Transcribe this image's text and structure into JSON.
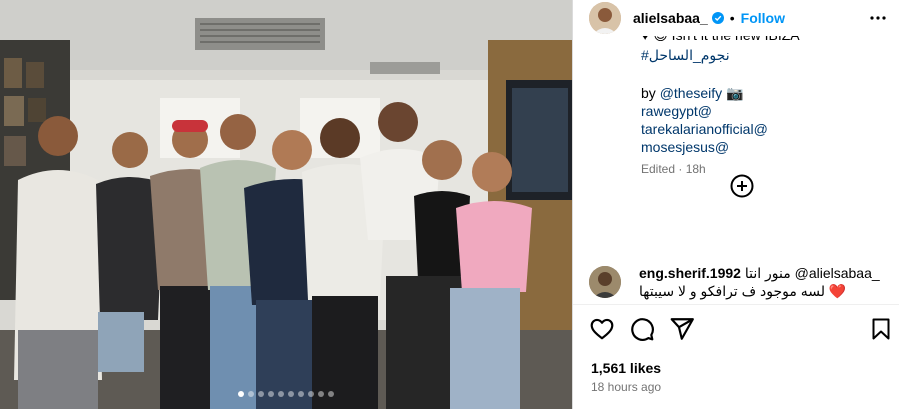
{
  "post": {
    "username": "alielsabaa_",
    "separator": "•",
    "follow_label": "Follow"
  },
  "caption": {
    "partial_line": "♥ 😊 Isn't it the new IBIZA",
    "hashtag": "#نجوم_الساحل",
    "credit_prefix": "by ",
    "credit_handle": "@theseify",
    "credit_emoji": "📷",
    "mentions": [
      "rawegypt@",
      "tarekalarianofficial@",
      "mosesjesus@"
    ],
    "edited": "Edited",
    "meta_sep": " · ",
    "edited_time": "18h"
  },
  "comment": {
    "user": "eng.sherif.1992",
    "text_line1": "منور انتا @alielsabaa_",
    "text_line2": "لسه موجود ف ترافكو و لا سيبتها ❤️"
  },
  "stats": {
    "likes": "1,561 likes",
    "time_ago": "18 hours ago"
  },
  "icons": {
    "verified": "verified-badge-icon",
    "more": "more-options-icon",
    "add": "add-circle-icon",
    "like": "heart-icon",
    "comment": "comment-icon",
    "share": "share-icon",
    "save": "bookmark-icon"
  },
  "colors": {
    "accent": "#0095f6",
    "link": "#00376b",
    "muted": "#737373"
  },
  "carousel": {
    "dot_count": 10,
    "active_index": 0
  }
}
